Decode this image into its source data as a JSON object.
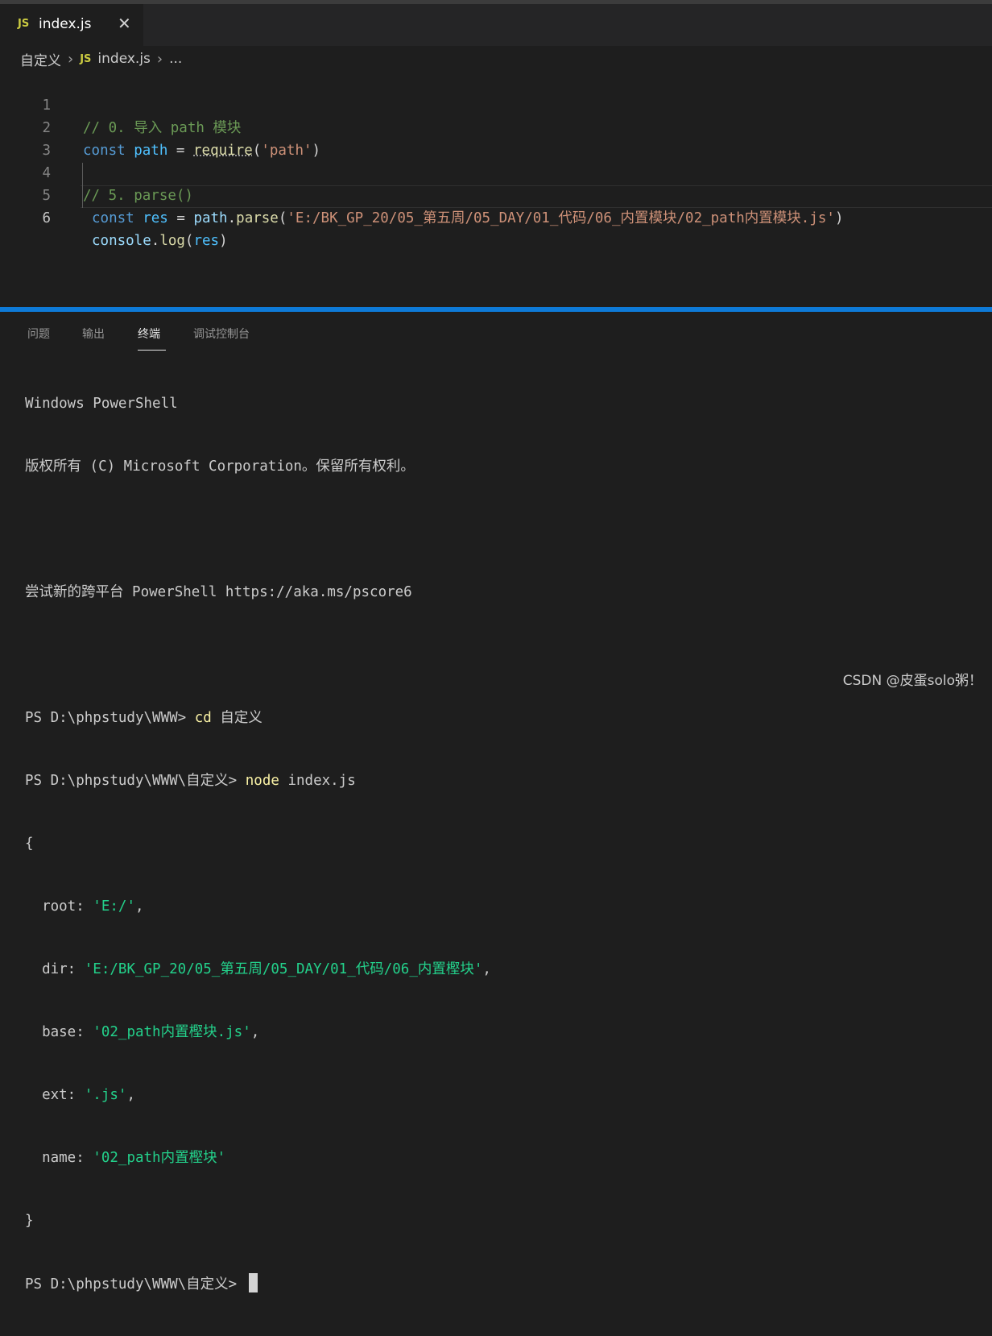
{
  "tab": {
    "icon": "JS",
    "label": "index.js",
    "close": "✕"
  },
  "breadcrumb": {
    "folder": "自定义",
    "sep": "›",
    "icon": "JS",
    "file": "index.js",
    "more": "..."
  },
  "editor": {
    "lines": [
      {
        "num": "1",
        "t": "// 0. 导入 path 模块"
      },
      {
        "num": "2",
        "t": {
          "kw": "const",
          "var": "path",
          "eq": " = ",
          "fn": "require",
          "open": "(",
          "str": "'path'",
          "close": ")"
        }
      },
      {
        "num": "3"
      },
      {
        "num": "4",
        "t": "// 5. parse()"
      },
      {
        "num": "5",
        "t": {
          "kw": "const",
          "var": "res",
          "eq": " = ",
          "obj": "path",
          "dot": ".",
          "fn": "parse",
          "open": "(",
          "str": "'E:/BK_GP_20/05_第五周/05_DAY/01_代码/06_内置模块/02_path内置模块.js'",
          "close": ")"
        }
      },
      {
        "num": "6",
        "t": {
          "obj": "console",
          "dot": ".",
          "fn": "log",
          "open": "(",
          "arg": "res",
          "close": ")"
        }
      }
    ]
  },
  "panel": {
    "tabs": [
      "问题",
      "输出",
      "终端",
      "调试控制台"
    ],
    "active_tab": "终端"
  },
  "terminal": {
    "l1": "Windows PowerShell",
    "l2": "版权所有 (C) Microsoft Corporation。保留所有权利。",
    "l4": "尝试新的跨平台 PowerShell https://aka.ms/pscore6",
    "p1": "PS D:\\phpstudy\\WWW> ",
    "c1": "cd",
    "a1": " 自定义",
    "p2": "PS D:\\phpstudy\\WWW\\自定义> ",
    "c2": "node",
    "a2": " index.js",
    "brace_open": "{",
    "root_k": "  root: ",
    "root_v": "'E:/'",
    "root_e": ",",
    "dir_k": "  dir: ",
    "dir_v": "'E:/BK_GP_20/05_第五周/05_DAY/01_代码/06_内置樫块'",
    "dir_e": ",",
    "base_k": "  base: ",
    "base_v": "'02_path内置樫块.js'",
    "base_e": ",",
    "ext_k": "  ext: ",
    "ext_v": "'.js'",
    "ext_e": ",",
    "name_k": "  name: ",
    "name_v": "'02_path内置樫块'",
    "brace_close": "}",
    "p3": "PS D:\\phpstudy\\WWW\\自定义> "
  },
  "watermark": "CSDN @皮蛋solo粥！",
  "colors": {
    "accent": "#0e7ad7",
    "js_icon": "#cbcb41"
  }
}
